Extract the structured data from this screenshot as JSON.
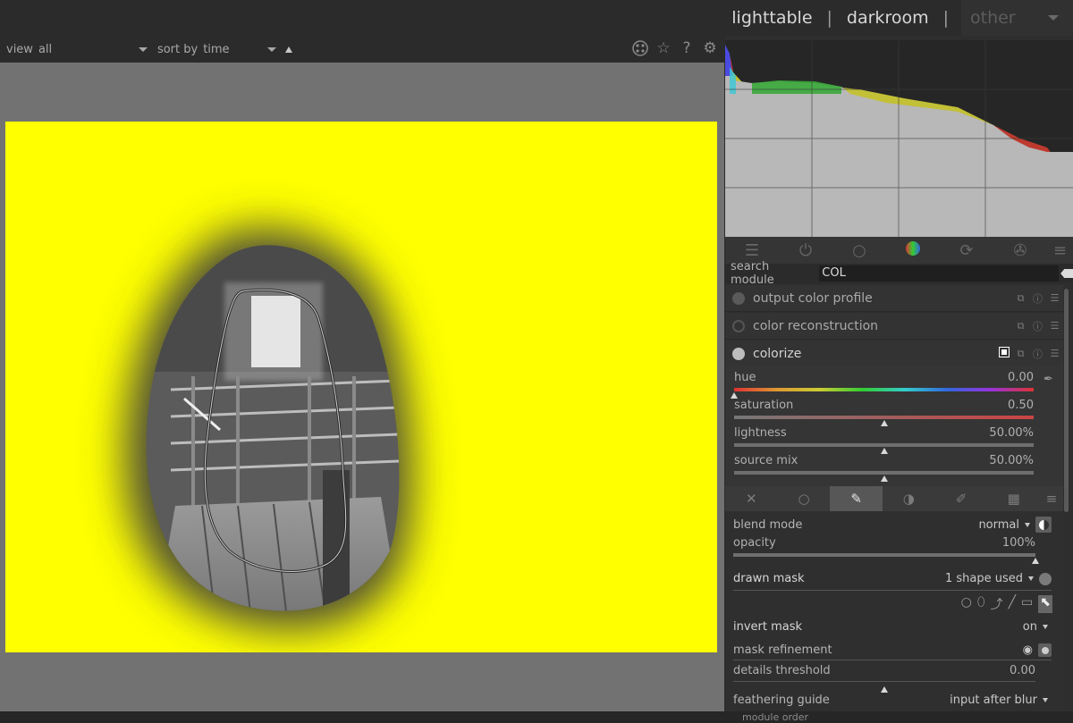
{
  "header": {
    "views": {
      "lighttable": "lighttable",
      "darkroom": "darkroom",
      "sep": "|",
      "other": "other"
    }
  },
  "filterbar": {
    "view_label": "view",
    "view_value": "all",
    "sort_label": "sort by",
    "sort_value": "time",
    "icons": [
      "presets-icon",
      "star-icon",
      "help-icon",
      "gear-icon"
    ]
  },
  "right_panel": {
    "group_tabs": [
      "quick-access-icon",
      "active-modules-icon",
      "base-icon",
      "color-icon",
      "correct-icon",
      "effect-icon",
      "menu-icon"
    ],
    "search": {
      "label": "search module",
      "value": "COL"
    },
    "modules": [
      {
        "name": "output color profile",
        "enabled": true
      },
      {
        "name": "color reconstruction",
        "enabled": false
      },
      {
        "name": "colorize",
        "enabled": true,
        "expanded": true
      }
    ],
    "colorize": {
      "hue": {
        "label": "hue",
        "value": "0.00",
        "level": 0.0
      },
      "saturation": {
        "label": "saturation",
        "value": "0.50",
        "level": 0.5
      },
      "lightness": {
        "label": "lightness",
        "value": "50.00%",
        "level": 0.5
      },
      "source_mix": {
        "label": "source mix",
        "value": "50.00%",
        "level": 0.5
      }
    },
    "blend": {
      "blend_mode": {
        "label": "blend mode",
        "value": "normal"
      },
      "opacity": {
        "label": "opacity",
        "value": "100%",
        "level": 1.0
      },
      "drawn_mask": {
        "label": "drawn mask",
        "value": "1 shape used"
      },
      "invert_mask": {
        "label": "invert mask",
        "value": "on"
      },
      "mask_refinement": {
        "label": "mask refinement"
      },
      "details_threshold": {
        "label": "details threshold",
        "value": "0.00",
        "level": 0.5
      },
      "feathering_guide": {
        "label": "feathering guide",
        "value": "input after blur"
      }
    },
    "module_order": "module order"
  },
  "colors": {
    "accent_yellow": "#ffff00",
    "panel": "#2e2e2e",
    "canvas_bg": "#727272"
  }
}
